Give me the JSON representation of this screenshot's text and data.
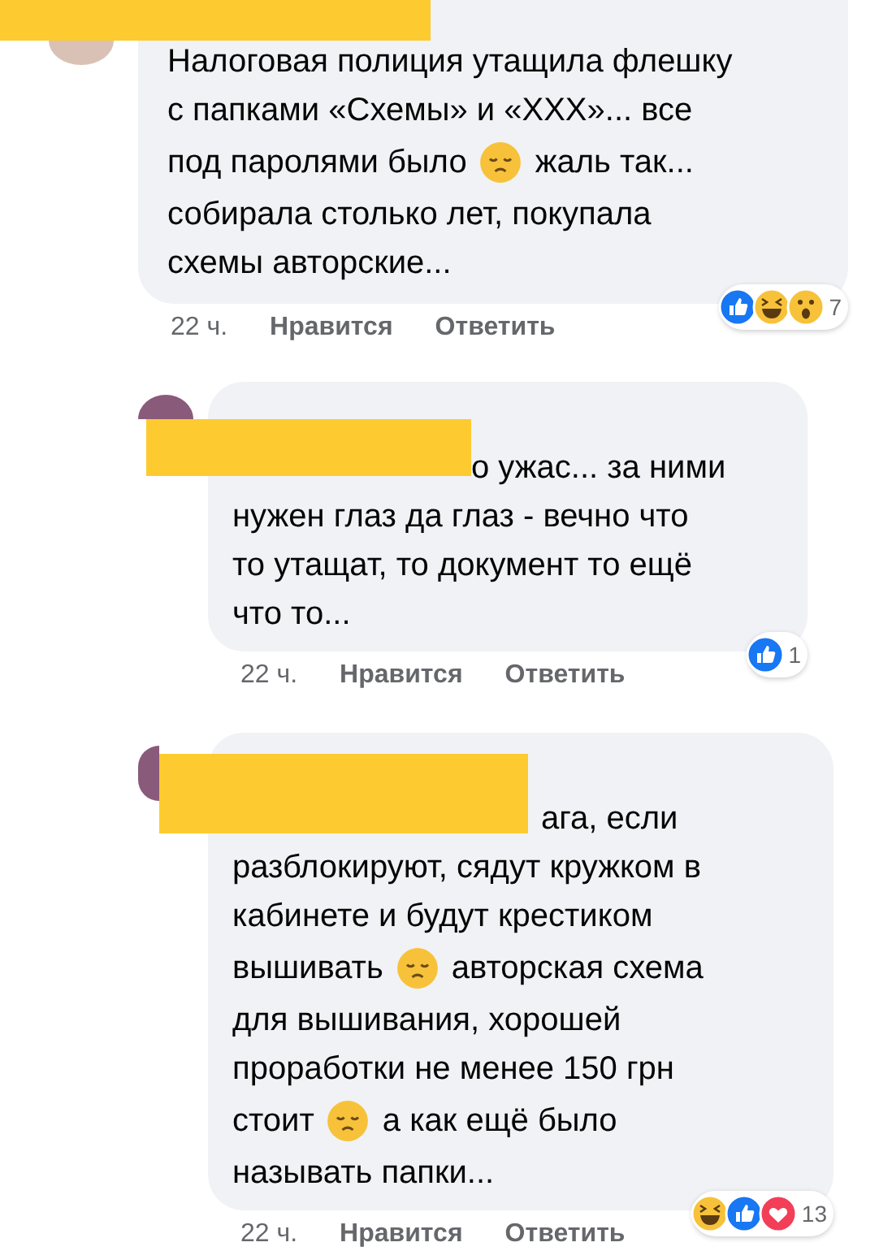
{
  "comments": [
    {
      "kind": "comment",
      "name_redacted": true,
      "lines": [
        {
          "segments": [
            {
              "kind": "text",
              "text": "Налоговая полиция утащила флешку"
            }
          ]
        },
        {
          "segments": [
            {
              "kind": "text",
              "text": "с папками «Схемы» и «ХХХ»... все"
            }
          ]
        },
        {
          "segments": [
            {
              "kind": "text",
              "text": "под паролями было"
            },
            {
              "kind": "emoji"
            },
            {
              "kind": "text",
              "text": "жаль так..."
            }
          ]
        },
        {
          "segments": [
            {
              "kind": "text",
              "text": "собирала столько лет, покупала"
            }
          ]
        },
        {
          "segments": [
            {
              "kind": "text",
              "text": "схемы авторские..."
            }
          ]
        }
      ],
      "time": "22 ч.",
      "like": "Нравится",
      "reply": "Ответить",
      "reactions": [
        {
          "kind": "like"
        },
        {
          "kind": "haha"
        },
        {
          "kind": "wow"
        }
      ],
      "reaction_count": "7"
    },
    {
      "kind": "reply",
      "name_redacted": true,
      "lines": [
        {
          "segments": [
            {
              "kind": "text",
              "text": "о ужас... за ними"
            }
          ]
        },
        {
          "segments": [
            {
              "kind": "text",
              "text": "нужен глаз да глаз - вечно что"
            }
          ]
        },
        {
          "segments": [
            {
              "kind": "text",
              "text": "то утащат, то документ то ещё"
            }
          ]
        },
        {
          "segments": [
            {
              "kind": "text",
              "text": "что то..."
            }
          ]
        }
      ],
      "time": "22 ч.",
      "like": "Нравится",
      "reply": "Ответить",
      "reactions": [
        {
          "kind": "like"
        }
      ],
      "reaction_count": "1"
    },
    {
      "kind": "reply",
      "name_redacted": true,
      "lines": [
        {
          "segments": [
            {
              "kind": "text",
              "text": "ага, если"
            }
          ]
        },
        {
          "segments": [
            {
              "kind": "text",
              "text": "разблокируют, сядут кружком в"
            }
          ]
        },
        {
          "segments": [
            {
              "kind": "text",
              "text": "кабинете и будут крестиком"
            }
          ]
        },
        {
          "segments": [
            {
              "kind": "text",
              "text": "вышивать"
            },
            {
              "kind": "emoji"
            },
            {
              "kind": "text",
              "text": "авторская схема"
            }
          ]
        },
        {
          "segments": [
            {
              "kind": "text",
              "text": "для вышивания, хорошей"
            }
          ]
        },
        {
          "segments": [
            {
              "kind": "text",
              "text": "проработки не менее 150 грн"
            }
          ]
        },
        {
          "segments": [
            {
              "kind": "text",
              "text": "стоит"
            },
            {
              "kind": "emoji"
            },
            {
              "kind": "text",
              "text": "а как ещё было"
            }
          ]
        },
        {
          "segments": [
            {
              "kind": "text",
              "text": "называть папки..."
            }
          ]
        }
      ],
      "time": "22 ч.",
      "like": "Нравится",
      "reply": "Ответить",
      "reactions": [
        {
          "kind": "haha"
        },
        {
          "kind": "like"
        },
        {
          "kind": "love"
        }
      ],
      "reaction_count": "13"
    }
  ]
}
